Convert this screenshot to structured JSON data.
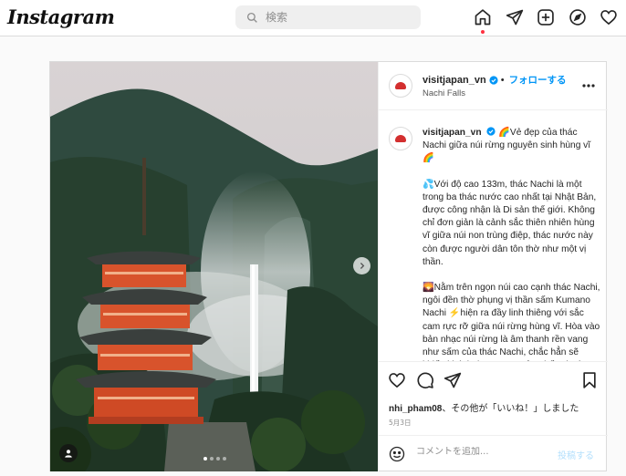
{
  "header": {
    "logo": "Instagram",
    "search_placeholder": "検索",
    "nav_icons": [
      "home-icon",
      "direct-message-icon",
      "new-post-icon",
      "explore-icon",
      "activity-heart-icon"
    ],
    "home_has_notification": true
  },
  "post": {
    "username": "visitjapan_vn",
    "verified": true,
    "follow_label": "フォローする",
    "separator": "•",
    "location": "Nachi Falls",
    "caption_username": "visitjapan_vn",
    "caption_paragraphs": [
      "🌈Vẻ đẹp của thác Nachi giữa núi rừng nguyên sinh hùng vĩ🌈",
      "💦Với độ cao 133m, thác Nachi là một trong ba thác nước cao nhất tại Nhật Bản, được công nhận là Di sản thế giới. Không chỉ đơn giản là cảnh sắc thiên nhiên hùng vĩ giữa núi non trùng điệp, thác nước này còn được người dân tôn thờ như một vị thần.",
      "🌄Nằm trên ngọn núi cao cạnh thác Nachi, ngôi đền thờ phụng vị thần sấm Kumano Nachi ⚡hiện ra đầy linh thiêng với sắc cam rực rỡ giữa núi rừng hùng vĩ. Hòa vào bản nhạc núi rừng là âm thanh rền vang như sấm của thác Nachi, chắc hẳn sẽ khiến khách tham quan cảm thấy choáng ngợp."
    ],
    "likes_user": "nhi_pham08",
    "likes_text": "、その他が「いいね！」しました",
    "date": "5月3日",
    "comment_placeholder": "コメントを追加...",
    "post_button": "投稿する",
    "carousel_total": 4,
    "carousel_active": 1
  },
  "colors": {
    "accent": "#0095f6",
    "post_disabled": "#b2dffc",
    "notification": "#ff3040",
    "pagoda": "#d8532c"
  }
}
